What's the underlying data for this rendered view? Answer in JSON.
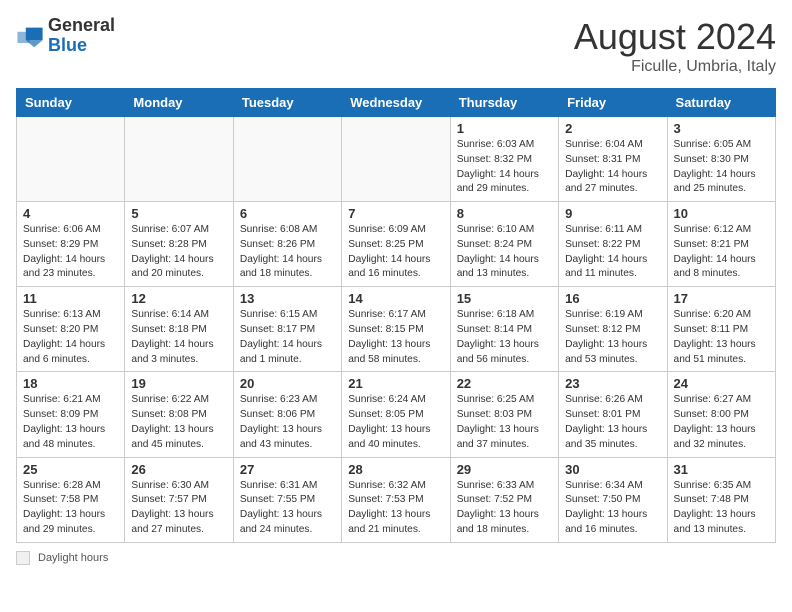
{
  "logo": {
    "general": "General",
    "blue": "Blue"
  },
  "title": {
    "month_year": "August 2024",
    "location": "Ficulle, Umbria, Italy"
  },
  "days_of_week": [
    "Sunday",
    "Monday",
    "Tuesday",
    "Wednesday",
    "Thursday",
    "Friday",
    "Saturday"
  ],
  "weeks": [
    [
      {
        "day": "",
        "info": ""
      },
      {
        "day": "",
        "info": ""
      },
      {
        "day": "",
        "info": ""
      },
      {
        "day": "",
        "info": ""
      },
      {
        "day": "1",
        "info": "Sunrise: 6:03 AM\nSunset: 8:32 PM\nDaylight: 14 hours and 29 minutes."
      },
      {
        "day": "2",
        "info": "Sunrise: 6:04 AM\nSunset: 8:31 PM\nDaylight: 14 hours and 27 minutes."
      },
      {
        "day": "3",
        "info": "Sunrise: 6:05 AM\nSunset: 8:30 PM\nDaylight: 14 hours and 25 minutes."
      }
    ],
    [
      {
        "day": "4",
        "info": "Sunrise: 6:06 AM\nSunset: 8:29 PM\nDaylight: 14 hours and 23 minutes."
      },
      {
        "day": "5",
        "info": "Sunrise: 6:07 AM\nSunset: 8:28 PM\nDaylight: 14 hours and 20 minutes."
      },
      {
        "day": "6",
        "info": "Sunrise: 6:08 AM\nSunset: 8:26 PM\nDaylight: 14 hours and 18 minutes."
      },
      {
        "day": "7",
        "info": "Sunrise: 6:09 AM\nSunset: 8:25 PM\nDaylight: 14 hours and 16 minutes."
      },
      {
        "day": "8",
        "info": "Sunrise: 6:10 AM\nSunset: 8:24 PM\nDaylight: 14 hours and 13 minutes."
      },
      {
        "day": "9",
        "info": "Sunrise: 6:11 AM\nSunset: 8:22 PM\nDaylight: 14 hours and 11 minutes."
      },
      {
        "day": "10",
        "info": "Sunrise: 6:12 AM\nSunset: 8:21 PM\nDaylight: 14 hours and 8 minutes."
      }
    ],
    [
      {
        "day": "11",
        "info": "Sunrise: 6:13 AM\nSunset: 8:20 PM\nDaylight: 14 hours and 6 minutes."
      },
      {
        "day": "12",
        "info": "Sunrise: 6:14 AM\nSunset: 8:18 PM\nDaylight: 14 hours and 3 minutes."
      },
      {
        "day": "13",
        "info": "Sunrise: 6:15 AM\nSunset: 8:17 PM\nDaylight: 14 hours and 1 minute."
      },
      {
        "day": "14",
        "info": "Sunrise: 6:17 AM\nSunset: 8:15 PM\nDaylight: 13 hours and 58 minutes."
      },
      {
        "day": "15",
        "info": "Sunrise: 6:18 AM\nSunset: 8:14 PM\nDaylight: 13 hours and 56 minutes."
      },
      {
        "day": "16",
        "info": "Sunrise: 6:19 AM\nSunset: 8:12 PM\nDaylight: 13 hours and 53 minutes."
      },
      {
        "day": "17",
        "info": "Sunrise: 6:20 AM\nSunset: 8:11 PM\nDaylight: 13 hours and 51 minutes."
      }
    ],
    [
      {
        "day": "18",
        "info": "Sunrise: 6:21 AM\nSunset: 8:09 PM\nDaylight: 13 hours and 48 minutes."
      },
      {
        "day": "19",
        "info": "Sunrise: 6:22 AM\nSunset: 8:08 PM\nDaylight: 13 hours and 45 minutes."
      },
      {
        "day": "20",
        "info": "Sunrise: 6:23 AM\nSunset: 8:06 PM\nDaylight: 13 hours and 43 minutes."
      },
      {
        "day": "21",
        "info": "Sunrise: 6:24 AM\nSunset: 8:05 PM\nDaylight: 13 hours and 40 minutes."
      },
      {
        "day": "22",
        "info": "Sunrise: 6:25 AM\nSunset: 8:03 PM\nDaylight: 13 hours and 37 minutes."
      },
      {
        "day": "23",
        "info": "Sunrise: 6:26 AM\nSunset: 8:01 PM\nDaylight: 13 hours and 35 minutes."
      },
      {
        "day": "24",
        "info": "Sunrise: 6:27 AM\nSunset: 8:00 PM\nDaylight: 13 hours and 32 minutes."
      }
    ],
    [
      {
        "day": "25",
        "info": "Sunrise: 6:28 AM\nSunset: 7:58 PM\nDaylight: 13 hours and 29 minutes."
      },
      {
        "day": "26",
        "info": "Sunrise: 6:30 AM\nSunset: 7:57 PM\nDaylight: 13 hours and 27 minutes."
      },
      {
        "day": "27",
        "info": "Sunrise: 6:31 AM\nSunset: 7:55 PM\nDaylight: 13 hours and 24 minutes."
      },
      {
        "day": "28",
        "info": "Sunrise: 6:32 AM\nSunset: 7:53 PM\nDaylight: 13 hours and 21 minutes."
      },
      {
        "day": "29",
        "info": "Sunrise: 6:33 AM\nSunset: 7:52 PM\nDaylight: 13 hours and 18 minutes."
      },
      {
        "day": "30",
        "info": "Sunrise: 6:34 AM\nSunset: 7:50 PM\nDaylight: 13 hours and 16 minutes."
      },
      {
        "day": "31",
        "info": "Sunrise: 6:35 AM\nSunset: 7:48 PM\nDaylight: 13 hours and 13 minutes."
      }
    ]
  ],
  "footer": {
    "box_label": "Daylight hours"
  }
}
